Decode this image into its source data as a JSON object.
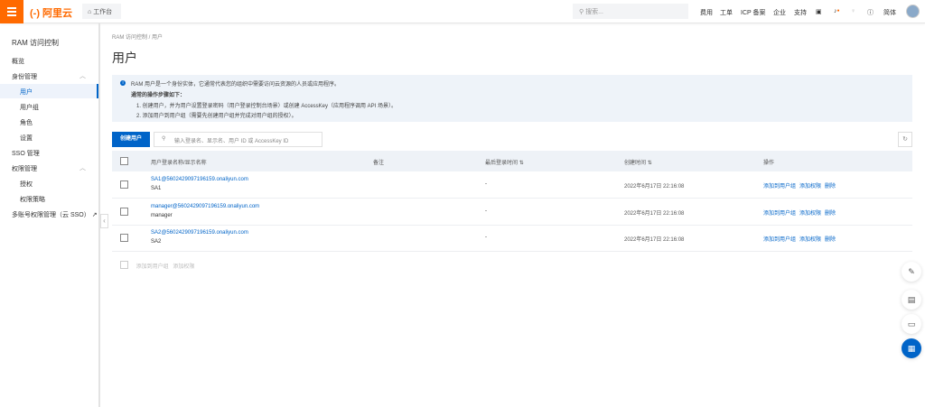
{
  "topbar": {
    "logo": "(-) 阿里云",
    "workspace": "工作台",
    "search_placeholder": "搜索...",
    "nav": [
      "费用",
      "工单",
      "ICP 备案",
      "企业",
      "支持"
    ],
    "lang": "简体"
  },
  "sidebar": {
    "title": "RAM 访问控制",
    "items": [
      {
        "label": "概览",
        "sub": false
      },
      {
        "label": "身份管理",
        "sub": false,
        "expand": true
      },
      {
        "label": "用户",
        "sub": true,
        "active": true
      },
      {
        "label": "用户组",
        "sub": true
      },
      {
        "label": "角色",
        "sub": true
      },
      {
        "label": "设置",
        "sub": true
      },
      {
        "label": "SSO 管理",
        "sub": false
      },
      {
        "label": "权限管理",
        "sub": false,
        "expand": true
      },
      {
        "label": "授权",
        "sub": true
      },
      {
        "label": "权限策略",
        "sub": true
      },
      {
        "label": "多账号权限管理（云 SSO）",
        "sub": false,
        "external": true
      }
    ]
  },
  "breadcrumb": [
    "RAM 访问控制",
    "用户"
  ],
  "page_title": "用户",
  "info": {
    "line1": "RAM 用户是一个身份实体，它通常代表您的组织中需要访问云资源的人员或应用程序。",
    "heading": "通常的操作步骤如下：",
    "step1": "1. 创建用户，并为用户设置登录密码（用户登录控制台场景）或创建 AccessKey（应用程序调用 API 场景）。",
    "step2": "2. 添加用户到用户组（需要先创建用户组并完成对用户组的授权）。"
  },
  "toolbar": {
    "create_label": "创建用户",
    "search_placeholder": "输入登录名、显示名、用户 ID 或 AccessKey ID"
  },
  "table": {
    "headers": [
      "用户登录名称/显示名称",
      "备注",
      "最后登录时间",
      "创建时间",
      "操作"
    ],
    "rows": [
      {
        "login": "SA1@5602429097196159.onaliyun.com",
        "display": "SA1",
        "note": "",
        "last_login": "-",
        "created": "2022年6月17日 22:16:08"
      },
      {
        "login": "manager@5602429097196159.onaliyun.com",
        "display": "manager",
        "note": "",
        "last_login": "-",
        "created": "2022年6月17日 22:16:08"
      },
      {
        "login": "SA2@5602429097196159.onaliyun.com",
        "display": "SA2",
        "note": "",
        "last_login": "-",
        "created": "2022年6月17日 22:16:08"
      }
    ],
    "actions": [
      "添加到用户组",
      "添加权限",
      "删除"
    ]
  },
  "footer": {
    "actions": [
      "添加到用户组",
      "添加权限"
    ]
  }
}
